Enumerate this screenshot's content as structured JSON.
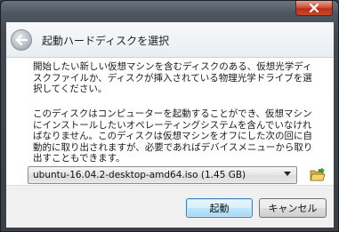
{
  "window": {
    "close_icon": "close-icon"
  },
  "header": {
    "back_icon": "back-arrow-icon",
    "title": "起動ハードディスクを選択"
  },
  "content": {
    "paragraph1": "開始したい新しい仮想マシンを含むディスクのある、仮想光学ディスクファイルか、ディスクが挿入されている物理光学ドライブを選択してください。",
    "paragraph2": "このディスクはコンピューターを起動することができ、仮想マシンにインストールしたいオペレーティングシステムを含んでいなければなりません。このディスクは仮想マシンをオフにした次の回に自動的に取り出されますが、必要であればデバイスメニューから取り出すこともできます。"
  },
  "combo": {
    "value": "ubuntu-16.04.2-desktop-amd64.iso (1.45 GB)",
    "arrow_icon": "dropdown-arrow-icon"
  },
  "folder_button": {
    "icon": "folder-open-icon"
  },
  "buttons": {
    "start": "起動",
    "cancel": "キャンセル"
  },
  "colors": {
    "titlebar": "#4e5660",
    "close": "#c8482c",
    "header": "#eef2f6",
    "content": "#ffffff",
    "footer": "#f0f0f0",
    "default_button_border": "#3c7fb1"
  }
}
